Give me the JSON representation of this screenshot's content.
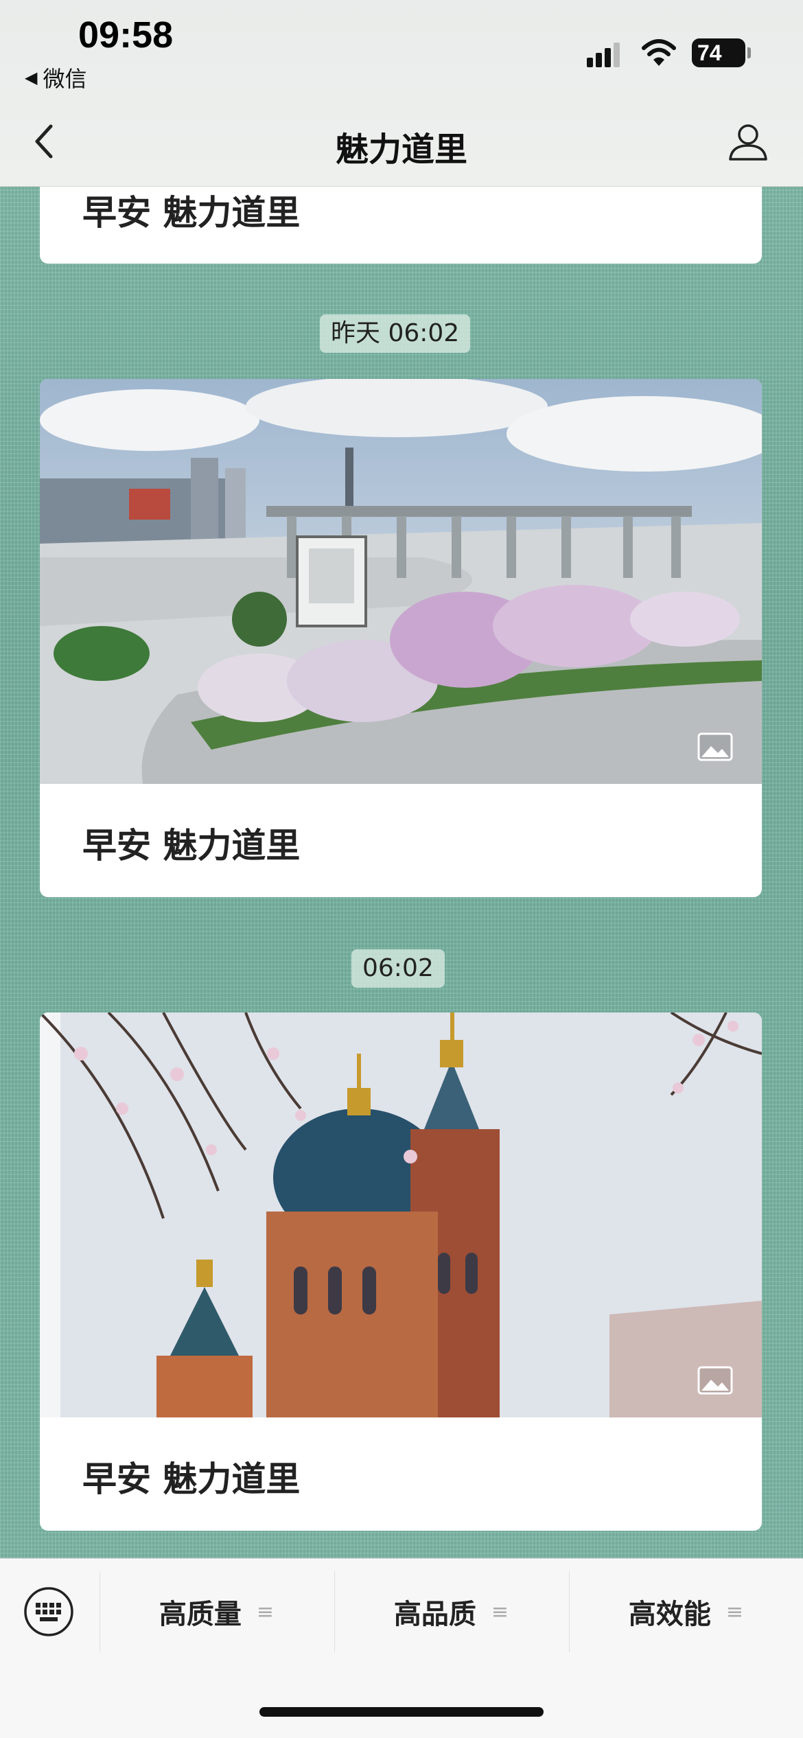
{
  "status_bar": {
    "time": "09:58",
    "back_app": "微信",
    "battery": "74"
  },
  "nav": {
    "title": "魅力道里"
  },
  "messages": [
    {
      "title": "早安 魅力道里"
    },
    {
      "timestamp": "昨天 06:02",
      "title": "早安 魅力道里"
    },
    {
      "timestamp": "06:02",
      "title": "早安 魅力道里"
    }
  ],
  "menu": [
    {
      "label": "高质量"
    },
    {
      "label": "高品质"
    },
    {
      "label": "高效能"
    }
  ],
  "icons": [
    "back-arrow-icon",
    "signal-icon",
    "wifi-icon",
    "battery-icon",
    "profile-icon",
    "image-icon",
    "keyboard-icon",
    "menu-lines-icon"
  ],
  "colors": {
    "chat_background": "#7fb9a8",
    "header": "#eceeed",
    "card": "#ffffff"
  }
}
